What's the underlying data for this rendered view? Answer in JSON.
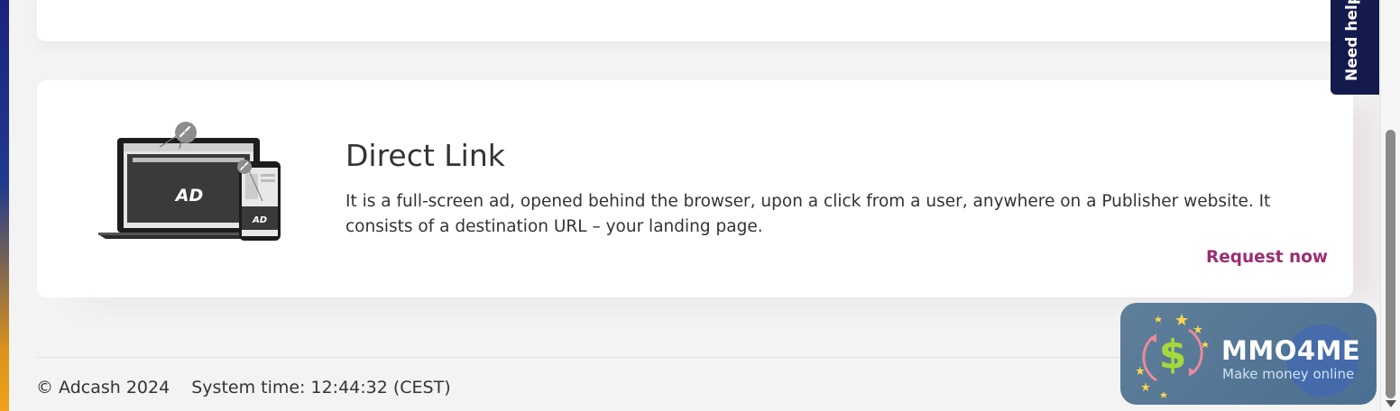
{
  "card": {
    "title": "Direct Link",
    "description": "It is a full-screen ad, opened behind the browser, upon a click from a user, anywhere on a Publisher website. It consists of a destination URL – your landing page.",
    "cta_label": "Request now",
    "illustration": {
      "laptop_ad_text": "AD",
      "phone_ad_text": "AD"
    }
  },
  "footer": {
    "copyright": "© Adcash 2024",
    "system_time": "System time: 12:44:32 (CEST)"
  },
  "help_tab": {
    "label": "Need help"
  },
  "badge": {
    "title": "MMO4ME",
    "subtitle": "Make money online",
    "currency_symbol": "$"
  },
  "colors": {
    "accent": "#9b2d70",
    "help_tab_bg": "#141a4b",
    "page_bg": "#f3f3f3"
  }
}
